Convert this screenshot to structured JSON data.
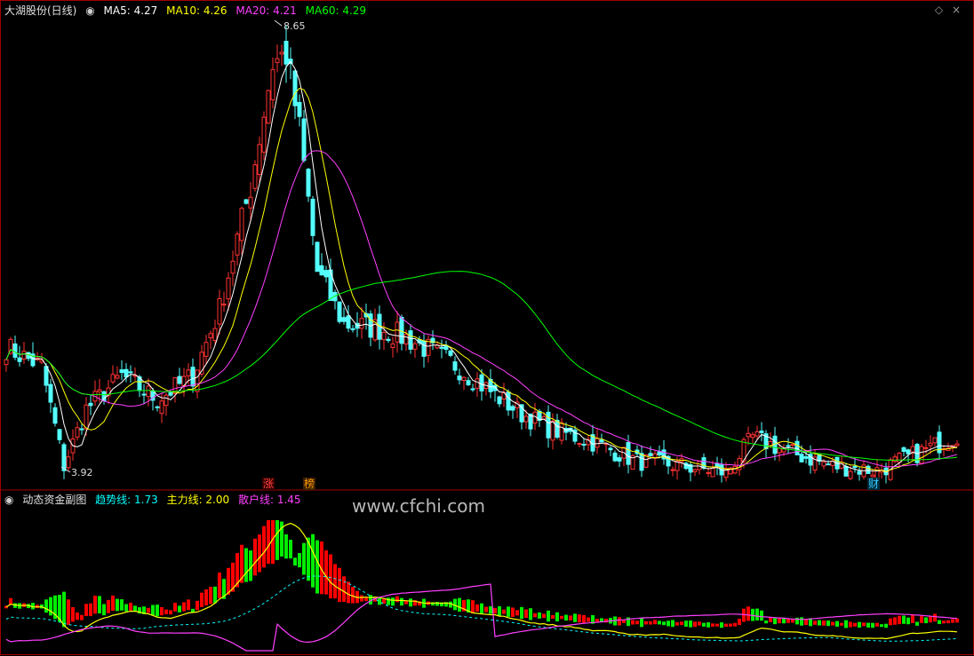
{
  "main_panel": {
    "title": "大湖股份(日线)",
    "ma_items": [
      {
        "label": "MA5: 4.27",
        "color": "#ffffff"
      },
      {
        "label": "MA10: 4.26",
        "color": "#ffff00"
      },
      {
        "label": "MA20: 4.21",
        "color": "#ff40ff"
      },
      {
        "label": "MA60: 4.29",
        "color": "#00ff00"
      }
    ],
    "high_label": "8.65",
    "low_label": "3.92",
    "flags": [
      {
        "text": "涨",
        "color": "#ff4040"
      },
      {
        "text": "榜",
        "color": "#ff9900"
      },
      {
        "text": "财",
        "color": "#33ccff"
      }
    ]
  },
  "sub_panel": {
    "title": "动态资金副图",
    "items": [
      {
        "label": "趋势线: 1.73",
        "color": "#00ffff"
      },
      {
        "label": "主力线: 2.00",
        "color": "#ffff00"
      },
      {
        "label": "散户线: 1.45",
        "color": "#ff40ff"
      }
    ]
  },
  "watermark": "www.cfchi.com",
  "colors": {
    "up": "#ff3232",
    "down": "#54ffff",
    "red_bar": "#ff0000",
    "green_bar": "#00ee00"
  },
  "chart_data": [
    {
      "type": "candlestick",
      "title": "大湖股份(日线)",
      "price_range": [
        3.92,
        8.65
      ],
      "series": [
        {
          "name": "MA5",
          "last": 4.27
        },
        {
          "name": "MA10",
          "last": 4.26
        },
        {
          "name": "MA20",
          "last": 4.21
        },
        {
          "name": "MA60",
          "last": 4.29
        }
      ],
      "annotations": [
        {
          "text": "8.65",
          "type": "high"
        },
        {
          "text": "3.92",
          "type": "low"
        }
      ]
    },
    {
      "type": "bar",
      "title": "动态资金副图",
      "series": [
        {
          "name": "趋势线",
          "last": 1.73
        },
        {
          "name": "主力线",
          "last": 2.0
        },
        {
          "name": "散户线",
          "last": 1.45
        }
      ]
    }
  ]
}
